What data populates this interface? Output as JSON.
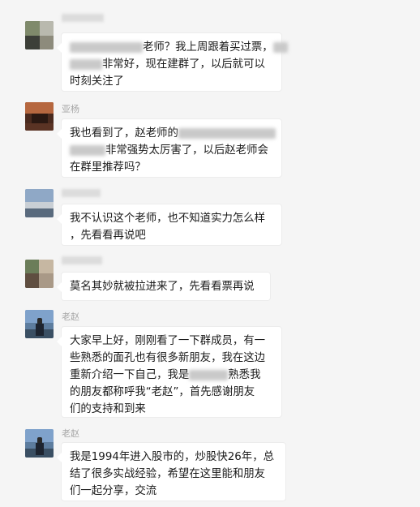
{
  "messages": [
    {
      "sender": "",
      "lines": [
        "老师？我上周跟着买过票，",
        "非常好，现在建群了，以后就可以",
        "时刻关注了"
      ]
    },
    {
      "sender": "亚杨",
      "lines": [
        "我也看到了，赵老师的",
        "非常强势太厉害了，以后赵老师会",
        "在群里推荐吗？"
      ]
    },
    {
      "sender": "",
      "lines": [
        "我不认识这个老师，也不知道实力怎么样",
        "，先看看再说吧"
      ]
    },
    {
      "sender": "",
      "lines": [
        "莫名其妙就被拉进来了，先看看票再说"
      ]
    },
    {
      "sender": "老赵",
      "lines": [
        "大家早上好，刚刚看了一下群成员，有一",
        "些熟悉的面孔也有很多新朋友，我在这边",
        "重新介绍一下自己，我是",
        "熟悉我",
        "的朋友都称呼我“老赵”，首先感谢朋友",
        "们的支持和到来"
      ]
    },
    {
      "sender": "老赵",
      "lines": [
        "我是1994年进入股市的，炒股快26年，总",
        "结了很多实战经验，希望在这里能和朋友",
        "们一起分享，交流"
      ]
    }
  ]
}
